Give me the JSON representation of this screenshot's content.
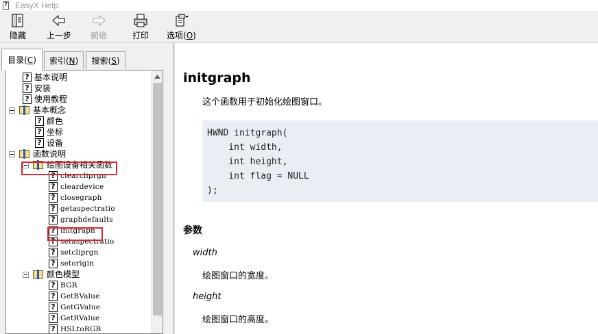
{
  "window": {
    "title": "EasyX Help"
  },
  "toolbar": {
    "buttons": [
      {
        "id": "hide",
        "label": "隐藏",
        "icon": "hide-pane-icon"
      },
      {
        "id": "back",
        "label": "上一步",
        "icon": "back-arrow-icon"
      },
      {
        "id": "forward",
        "label": "前进",
        "icon": "forward-arrow-icon",
        "disabled": true
      },
      {
        "id": "print",
        "label": "打印",
        "icon": "printer-icon"
      },
      {
        "id": "options",
        "label_main": "选项(",
        "label_key": "O",
        "label_end": ")",
        "icon": "options-icon"
      }
    ]
  },
  "tabs": [
    {
      "main": "目录(",
      "key": "C",
      "end": ")",
      "active": true
    },
    {
      "main": "索引(",
      "key": "N",
      "end": ")"
    },
    {
      "main": "搜索(",
      "key": "S",
      "end": ")"
    }
  ],
  "tree": {
    "items": [
      {
        "label": "基本说明",
        "type": "topic",
        "level": 1
      },
      {
        "label": "安装",
        "type": "topic",
        "level": 1
      },
      {
        "label": "使用教程",
        "type": "topic",
        "level": 1
      },
      {
        "label": "基本概念",
        "type": "book",
        "level": 0
      },
      {
        "label": "颜色",
        "type": "topic",
        "level": 2
      },
      {
        "label": "坐标",
        "type": "topic",
        "level": 2
      },
      {
        "label": "设备",
        "type": "topic",
        "level": 2
      },
      {
        "label": "函数说明",
        "type": "book",
        "level": 0
      },
      {
        "label": "绘图设备相关函数",
        "type": "book",
        "level": 1
      },
      {
        "label": "clearcliprgn",
        "type": "topic",
        "level": 3
      },
      {
        "label": "cleardevice",
        "type": "topic",
        "level": 3
      },
      {
        "label": "closegraph",
        "type": "topic",
        "level": 3
      },
      {
        "label": "getaspectratio",
        "type": "topic",
        "level": 3
      },
      {
        "label": "graphdefaults",
        "type": "topic",
        "level": 3
      },
      {
        "label": "initgraph",
        "type": "topic",
        "level": 3
      },
      {
        "label": "setaspectratio",
        "type": "topic",
        "level": 3
      },
      {
        "label": "setcliprgn",
        "type": "topic",
        "level": 3
      },
      {
        "label": "setorigin",
        "type": "topic",
        "level": 3
      },
      {
        "label": "颜色模型",
        "type": "book",
        "level": 1
      },
      {
        "label": "BGR",
        "type": "topic",
        "level": 3
      },
      {
        "label": "GetBValue",
        "type": "topic",
        "level": 3
      },
      {
        "label": "GetGValue",
        "type": "topic",
        "level": 3
      },
      {
        "label": "GetRValue",
        "type": "topic",
        "level": 3
      },
      {
        "label": "HSLtoRGB",
        "type": "topic",
        "level": 3
      }
    ]
  },
  "content": {
    "title": "initgraph",
    "description": "这个函数用于初始化绘图窗口。",
    "code": "HWND initgraph(\n    int width,\n    int height,\n    int flag = NULL\n);",
    "params_heading": "参数",
    "params": [
      {
        "name": "width",
        "desc": "绘图窗口的宽度。"
      },
      {
        "name": "height",
        "desc": "绘图窗口的高度。"
      }
    ]
  },
  "colors": {
    "highlight": "#e0262e",
    "code_bg": "#e8eef4"
  }
}
